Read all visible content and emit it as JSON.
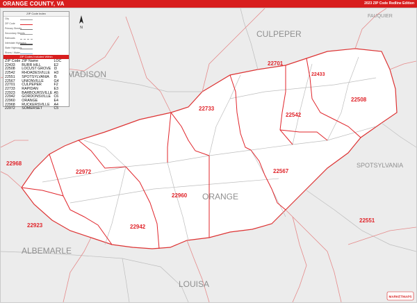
{
  "header": {
    "title": "ORANGE COUNTY, VA",
    "edition": "2023 ZIP Code Redline Edition"
  },
  "map": {
    "county_label": "ORANGE",
    "neighbors": [
      "CULPEPER",
      "FAUQUIER",
      "MADISON",
      "SPOTSYLVANIA",
      "ALBEMARLE",
      "LOUISA"
    ],
    "zip_labels": [
      "22701",
      "22433",
      "22508",
      "22733",
      "22542",
      "22972",
      "22968",
      "22567",
      "22960",
      "22551",
      "22923",
      "22942"
    ],
    "colors": {
      "accent": "#d81e1e",
      "county_fill": "#ffffff",
      "outside_fill": "#ececec",
      "zip_line": "#e0242a",
      "road": "#b5b5b5"
    }
  },
  "legend": {
    "title": "ZIP Code Index",
    "rows": [
      "City",
      "ZIP Code",
      "Primary Streets",
      "Secondary Streets",
      "Railroads",
      "Interstate Highways",
      "State Highways",
      "Rivers / Water",
      "Parks / Forest",
      "Airports",
      "Unincorporated"
    ],
    "zip_table_title": "ZIP Codes Included Within",
    "columns": [
      "ZIP Code",
      "ZIP Name",
      "LOC"
    ],
    "rows_data": [
      [
        "22433",
        "BURR HILL",
        "E2"
      ],
      [
        "22508",
        "LOCUST GROVE",
        "I3"
      ],
      [
        "22542",
        "RHOADESVILLE",
        "H3"
      ],
      [
        "22551",
        "SPOTSYLVANIA",
        "I5"
      ],
      [
        "22567",
        "UNIONVILLE",
        "G4"
      ],
      [
        "22701",
        "CULPEPER",
        "F2"
      ],
      [
        "22733",
        "RAPIDAN",
        "E3"
      ],
      [
        "22923",
        "BARBOURSVILLE",
        "A5"
      ],
      [
        "22942",
        "GORDONSVILLE",
        "C6"
      ],
      [
        "22960",
        "ORANGE",
        "E4"
      ],
      [
        "22968",
        "RUCKERSVILLE",
        "A4"
      ],
      [
        "22972",
        "SOMERSET",
        "C5"
      ]
    ],
    "zip_code_header_first": "ZIP Code"
  },
  "compass": {
    "north_label": "N"
  },
  "logo": {
    "text": "MARKETMAPS"
  }
}
